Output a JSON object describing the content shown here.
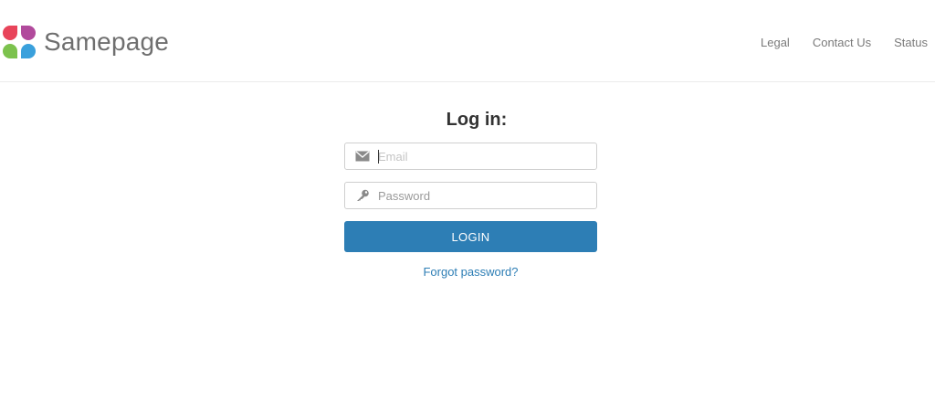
{
  "header": {
    "brand": "Samepage",
    "nav": {
      "legal": "Legal",
      "contact": "Contact Us",
      "status": "Status"
    },
    "logo_colors": [
      "#e8445a",
      "#b14a9c",
      "#7cc24d",
      "#3aa0dc"
    ]
  },
  "login": {
    "title": "Log in:",
    "email_placeholder": "Email",
    "password_placeholder": "Password",
    "login_label": "LOGIN",
    "forgot_label": "Forgot password?"
  },
  "colors": {
    "accent": "#2d7eb5"
  },
  "icons": {
    "email_field": "envelope-icon",
    "password_field": "key-icon"
  }
}
